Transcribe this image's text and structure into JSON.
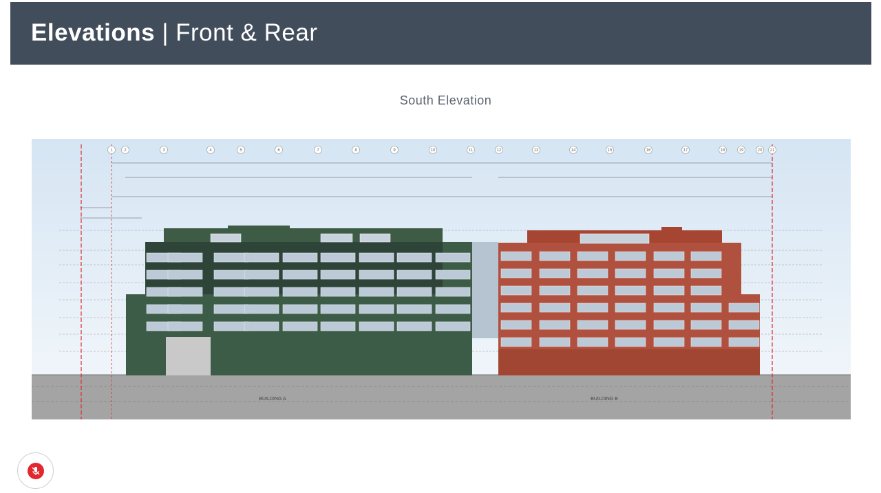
{
  "header": {
    "title_main": "Elevations",
    "title_sep": "|",
    "title_sub": "Front & Rear"
  },
  "diagram": {
    "heading": "South Elevation",
    "buildings": [
      {
        "label": "BUILDING A",
        "facade_color": "#3c5c47"
      },
      {
        "label": "BUILDING B",
        "facade_color": "#b0503e"
      }
    ],
    "grid_bubbles": [
      "1",
      "2",
      "3",
      "4",
      "5",
      "6",
      "7",
      "8",
      "9",
      "10",
      "11",
      "12",
      "13",
      "14",
      "15",
      "16",
      "17",
      "18",
      "19",
      "20",
      "21"
    ],
    "colors": {
      "sky": "#dde9f4",
      "ground": "#a4a4a4",
      "property_line": "#e0282e"
    }
  },
  "controls": {
    "mute_icon": "microphone-off-icon"
  }
}
